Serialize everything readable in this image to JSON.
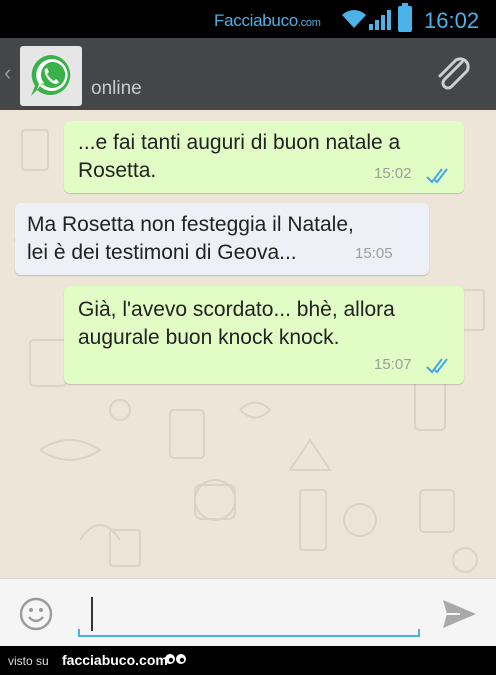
{
  "status_bar": {
    "brand": "Facciabuco",
    "brand_domain": ".com",
    "time": "16:02",
    "accent_color": "#4ab2e6",
    "icons": [
      "wifi-icon",
      "signal-icon",
      "battery-icon"
    ]
  },
  "action_bar": {
    "back_glyph": "‹",
    "avatar_icon": "whatsapp-logo-icon",
    "status": "online",
    "attach_icon": "paperclip-icon"
  },
  "messages": [
    {
      "direction": "out",
      "text": "...e fai tanti auguri di buon natale a\nRosetta.",
      "time": "15:02",
      "ticks": "double-check-icon"
    },
    {
      "direction": "in",
      "text": "Ma Rosetta non festeggia il Natale,\nlei è dei testimoni di Geova...",
      "time": "15:05"
    },
    {
      "direction": "out",
      "text": "Già, l'avevo scordato... bhè, allora\naugurale buon knock knock.",
      "time": "15:07",
      "ticks": "double-check-icon"
    }
  ],
  "input_bar": {
    "emoji_icon": "smiley-icon",
    "value": "",
    "send_icon": "send-icon"
  },
  "footer": {
    "label": "visto su",
    "site": "facciabuco.com"
  },
  "colors": {
    "outgoing_bubble": "#e2fcc6",
    "incoming_bubble": "#eef0f7",
    "chat_background": "#ece5d8",
    "action_bar": "#444647",
    "tick_blue": "#3fa9e6"
  }
}
